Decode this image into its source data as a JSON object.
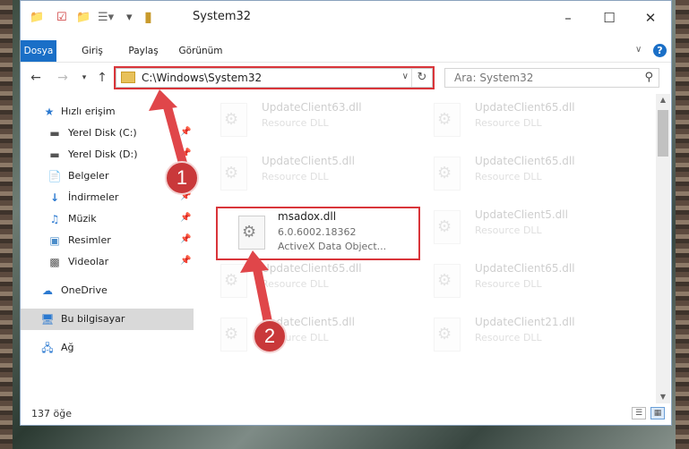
{
  "window": {
    "title": "System32"
  },
  "ribbon": {
    "tabs": [
      {
        "label": "Dosya"
      },
      {
        "label": "Giriş"
      },
      {
        "label": "Paylaş"
      },
      {
        "label": "Görünüm"
      }
    ]
  },
  "address": {
    "path": "C:\\Windows\\System32"
  },
  "search": {
    "placeholder": "Ara: System32"
  },
  "sidebar": {
    "items": [
      {
        "label": "Hızlı erişim"
      },
      {
        "label": "Yerel Disk (C:)"
      },
      {
        "label": "Yerel Disk (D:)"
      },
      {
        "label": "Belgeler"
      },
      {
        "label": "İndirmeler"
      },
      {
        "label": "Müzik"
      },
      {
        "label": "Resimler"
      },
      {
        "label": "Videolar"
      },
      {
        "label": "OneDrive"
      },
      {
        "label": "Bu bilgisayar"
      },
      {
        "label": "Ağ"
      }
    ]
  },
  "files": [
    {
      "name": "UpdateClient63.dll",
      "line1": "Resource DLL"
    },
    {
      "name": "UpdateClient65.dll",
      "line1": "Resource DLL"
    },
    {
      "name": "UpdateClient5.dll",
      "line1": "Resource DLL"
    },
    {
      "name": "UpdateClient65.dll",
      "line1": "Resource DLL"
    },
    {
      "name": "msadox.dll",
      "line1": "6.0.6002.18362",
      "line2": "ActiveX Data Object..."
    },
    {
      "name": "UpdateClient5.dll",
      "line1": "Resource DLL"
    },
    {
      "name": "UpdateClient65.dll",
      "line1": "Resource DLL"
    },
    {
      "name": "UpdateClient65.dll",
      "line1": "Resource DLL"
    },
    {
      "name": "UpdateClient5.dll",
      "line1": "Resource DLL"
    },
    {
      "name": "UpdateClient21.dll",
      "line1": "Resource DLL"
    }
  ],
  "status": {
    "item_count": "137 öğe"
  },
  "callouts": {
    "one": "1",
    "two": "2"
  },
  "colors": {
    "accent": "#1a6fc7",
    "highlight": "#d9353a"
  }
}
